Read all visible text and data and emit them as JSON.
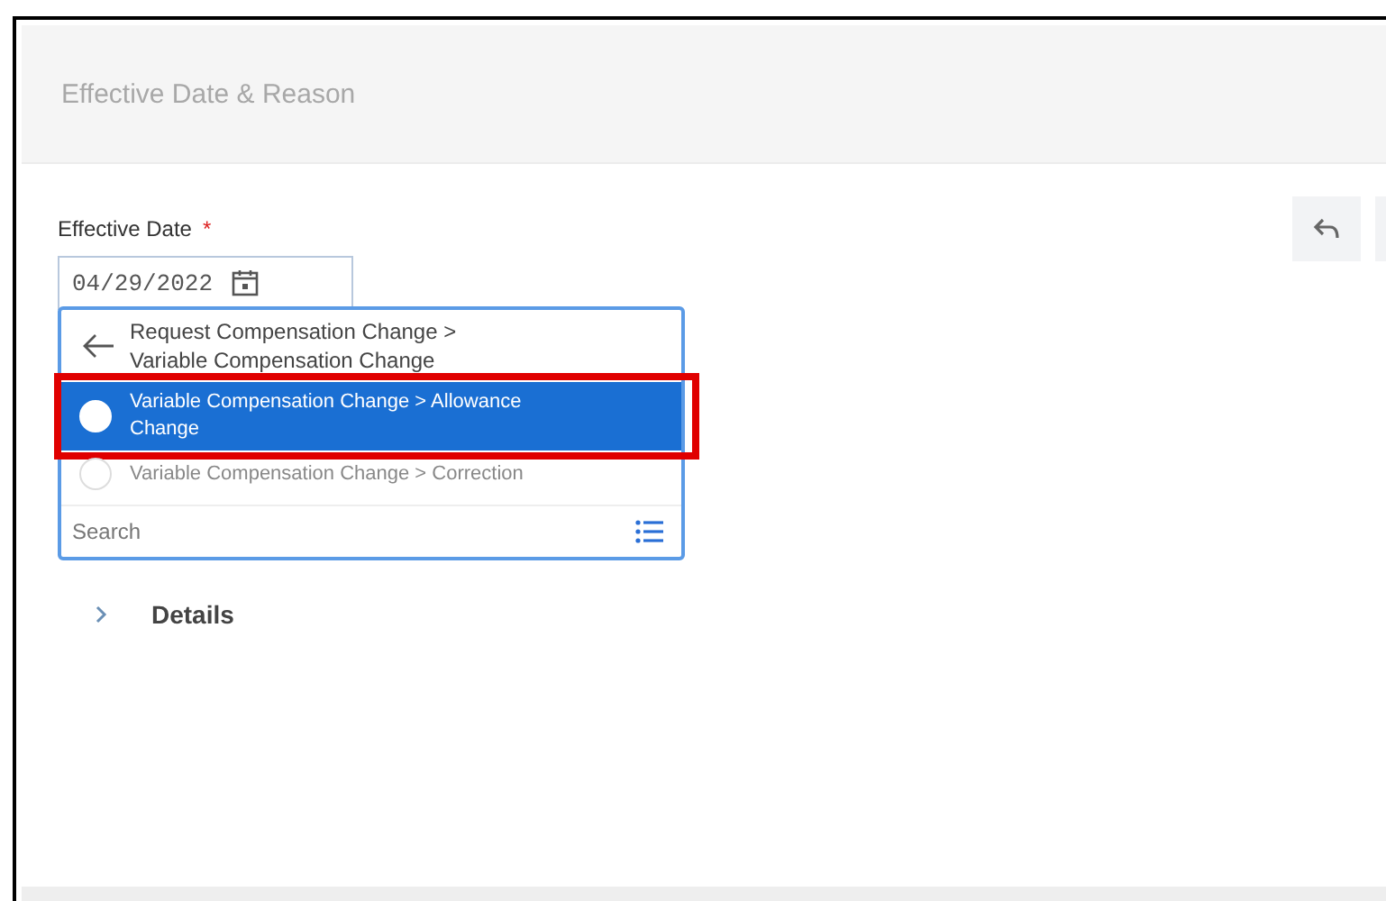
{
  "section": {
    "title": "Effective Date & Reason"
  },
  "field": {
    "label": "Effective Date",
    "required_mark": "*",
    "value": "04/29/2022"
  },
  "dropdown": {
    "back_header": "Request Compensation Change > Variable Compensation Change",
    "options": [
      {
        "label": "Variable Compensation Change > Allowance Change",
        "selected": true,
        "highlighted": true
      },
      {
        "label": "Variable Compensation Change > Correction",
        "selected": false,
        "highlighted": false
      }
    ],
    "search": {
      "placeholder": "Search"
    }
  },
  "details": {
    "label": "Details",
    "expanded": false
  }
}
